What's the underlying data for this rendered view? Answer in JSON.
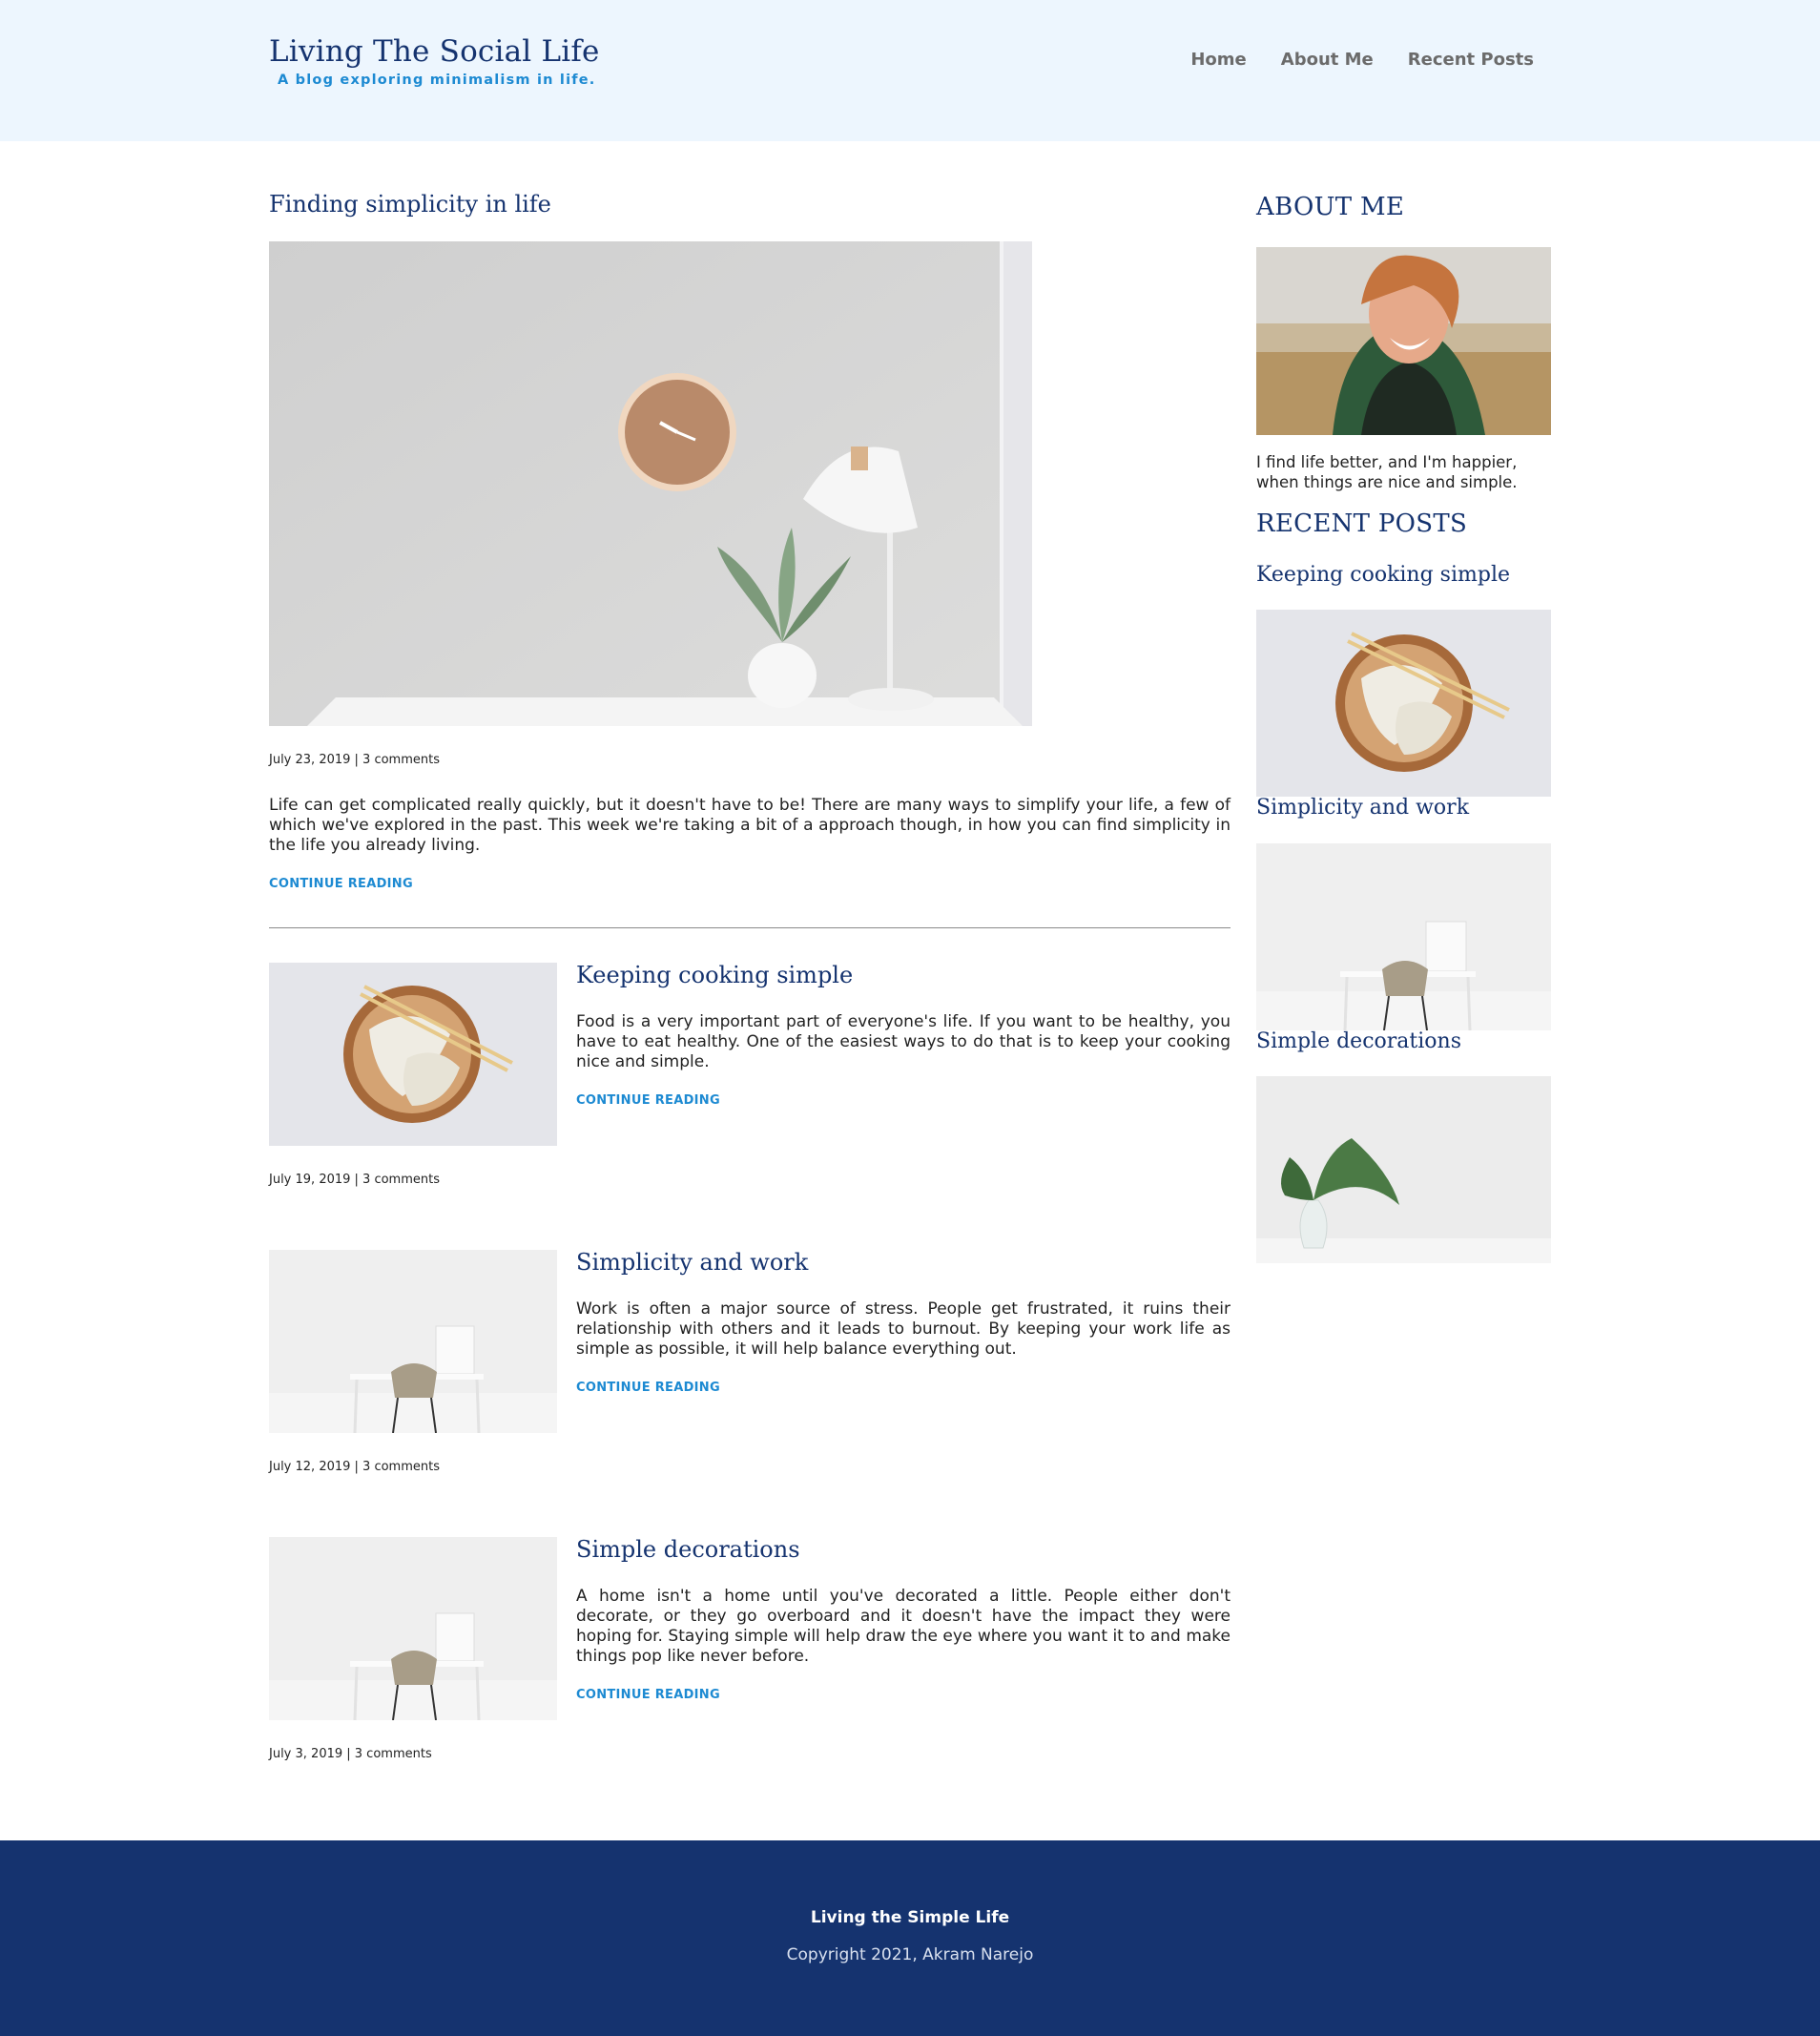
{
  "header": {
    "title": "Living The Social Life",
    "subtitle": "A blog exploring minimalism in life.",
    "nav": [
      "Home",
      "About Me",
      "Recent Posts"
    ]
  },
  "featured": {
    "title": "Finding simplicity in life",
    "meta": "July 23, 2019 | 3 comments",
    "excerpt": "Life can get complicated really quickly, but it doesn't have to be! There are many ways to simplify your life, a few of which we've explored in the past. This week we're taking a bit of a approach though, in how you can find simplicity in the life you already living.",
    "more": "CONTINUE READING"
  },
  "posts": [
    {
      "title": "Keeping cooking simple",
      "excerpt": "Food is a very important part of everyone's life. If you want to be healthy, you have to eat healthy. One of the easiest ways to do that is to keep your cooking nice and simple.",
      "more": "CONTINUE READING",
      "meta": "July 19, 2019 | 3 comments"
    },
    {
      "title": "Simplicity and work",
      "excerpt": "Work is often a major source of stress. People get frustrated, it ruins their relationship with others and it leads to burnout. By keeping your work life as simple as possible, it will help balance everything out.",
      "more": "CONTINUE READING",
      "meta": "July 12, 2019 | 3 comments"
    },
    {
      "title": "Simple decorations",
      "excerpt": "A home isn't a home until you've decorated a little. People either don't decorate, or they go overboard and it doesn't have the impact they were hoping for. Staying simple will help draw the eye where you want it to and make things pop like never before.",
      "more": "CONTINUE READING",
      "meta": "July 3, 2019 | 3 comments"
    }
  ],
  "sidebar": {
    "about_heading": "ABOUT ME",
    "about_text": "I find life better, and I'm happier, when things are nice and simple.",
    "recent_heading": "RECENT POSTS",
    "recent": [
      "Keeping cooking simple",
      "Simplicity and work",
      "Simple decorations"
    ]
  },
  "footer": {
    "title": "Living the Simple Life",
    "copyright": "Copyright 2021, Akram Narejo"
  }
}
